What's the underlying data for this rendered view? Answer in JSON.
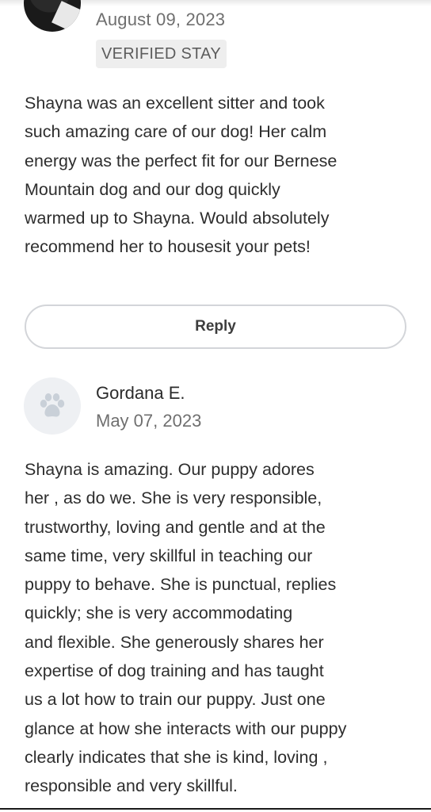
{
  "reviews": [
    {
      "date": "August 09, 2023",
      "badge": "VERIFIED STAY",
      "text": "Shayna was an excellent sitter and took\nsuch amazing care of our dog! Her calm\nenergy was the perfect fit for our Bernese\nMountain dog and our dog quickly\nwarmed up to Shayna. Would absolutely\nrecommend her to housesit your pets!",
      "reply_label": "Reply"
    },
    {
      "name": "Gordana E.",
      "date": "May 07, 2023",
      "text": "Shayna is amazing. Our puppy adores\nher , as do we. She is very responsible,\ntrustworthy, loving and gentle and at the\nsame time, very skillful in teaching our\npuppy to behave. She is punctual, replies\nquickly; she is very accommodating\nand flexible. She generously shares her\nexpertise of dog training and has taught\nus a lot how to train our puppy. Just one\nglance at how she interacts with our puppy\nclearly indicates that she is kind, loving ,\nresponsible and very skillful."
    }
  ],
  "icons": {
    "avatar_photo": "reviewer-photo",
    "avatar_placeholder": "paw-icon"
  },
  "colors": {
    "text": "#2e2e2e",
    "muted": "#6f6f6f",
    "badge_bg": "#eeeeee",
    "button_border": "#d3d5d9",
    "paw_bg": "#eef0f3",
    "paw": "#c9d0d8"
  }
}
